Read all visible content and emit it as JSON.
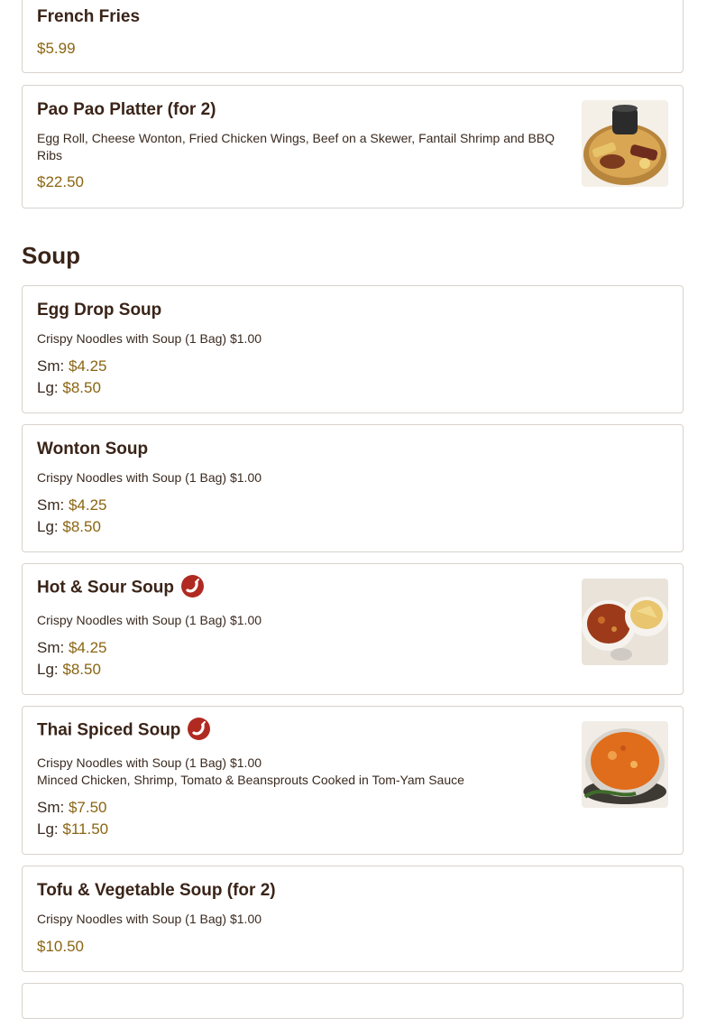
{
  "items_top": [
    {
      "name": "French Fries",
      "price": "$5.99"
    },
    {
      "name": "Pao Pao Platter (for 2)",
      "desc": "Egg Roll, Cheese Wonton, Fried Chicken Wings, Beef on a Skewer, Fantail Shrimp and BBQ Ribs",
      "price": "$22.50"
    }
  ],
  "section": {
    "title": "Soup"
  },
  "soups": [
    {
      "name": "Egg Drop Soup",
      "desc": "Crispy Noodles with Soup (1 Bag) $1.00",
      "sm_label": "Sm:",
      "sm_price": "$4.25",
      "lg_label": "Lg:",
      "lg_price": "$8.50"
    },
    {
      "name": "Wonton Soup",
      "desc": "Crispy Noodles with Soup (1 Bag) $1.00",
      "sm_label": "Sm:",
      "sm_price": "$4.25",
      "lg_label": "Lg:",
      "lg_price": "$8.50"
    },
    {
      "name": "Hot & Sour Soup",
      "desc": "Crispy Noodles with Soup (1 Bag) $1.00",
      "sm_label": "Sm:",
      "sm_price": "$4.25",
      "lg_label": "Lg:",
      "lg_price": "$8.50",
      "icon": "spicy-chili-icon"
    },
    {
      "name": "Thai Spiced Soup",
      "desc": "Crispy Noodles with Soup (1 Bag) $1.00",
      "desc2": "Minced Chicken, Shrimp, Tomato & Beansprouts Cooked in Tom-Yam Sauce",
      "sm_label": "Sm:",
      "sm_price": "$7.50",
      "lg_label": "Lg:",
      "lg_price": "$11.50",
      "icon": "spicy-chili-icon"
    },
    {
      "name": "Tofu & Vegetable Soup (for 2)",
      "desc": "Crispy Noodles with Soup (1 Bag) $1.00",
      "price": "$10.50"
    }
  ],
  "colors": {
    "price": "#8a6512",
    "spicy": "#b02a22",
    "border": "#d8d2cc"
  }
}
